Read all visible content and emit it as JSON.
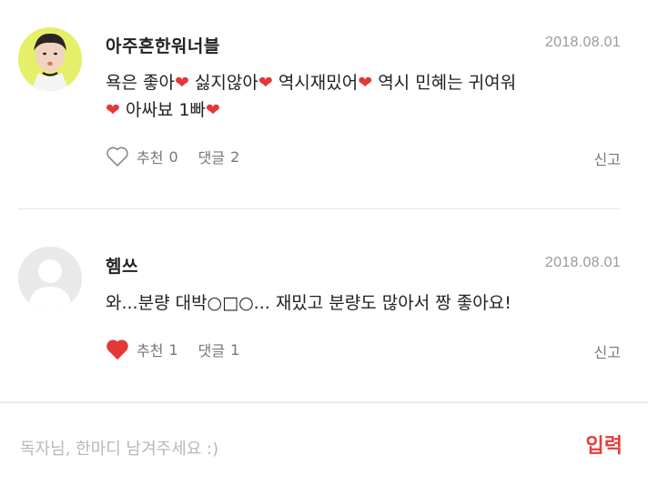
{
  "comments": [
    {
      "username": "아주흔한워너블",
      "date": "2018.08.01",
      "text_segments": [
        "욕은 좋아",
        "❤",
        " 싫지않아",
        "❤",
        " 역시재밌어",
        "❤",
        " 역시 민혜는 귀여워 ",
        "❤",
        " 아싸뵤 1빠",
        "❤"
      ],
      "like_label": "추천",
      "like_count": "0",
      "reply_label": "댓글",
      "reply_count": "2",
      "liked": false,
      "report_label": "신고"
    },
    {
      "username": "헴쓰",
      "date": "2018.08.01",
      "text": "와...분량 대박○□○... 재밌고 분량도 많아서 짱 좋아요!",
      "like_label": "추천",
      "like_count": "1",
      "reply_label": "댓글",
      "reply_count": "1",
      "liked": true,
      "report_label": "신고"
    }
  ],
  "footer": {
    "placeholder": "독자님, 한마디 남겨주세요 :)",
    "submit_label": "입력"
  },
  "colors": {
    "accent": "#e2403f",
    "heart": "#e23838",
    "muted": "#9a9a9a"
  }
}
